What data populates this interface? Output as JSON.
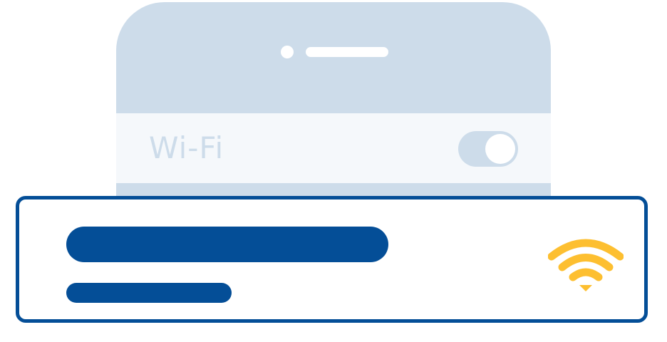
{
  "settings": {
    "wifi_label": "Wi-Fi",
    "wifi_enabled": true
  },
  "network": {
    "icon": "wifi-signal-icon"
  },
  "colors": {
    "phone_body": "#cddcea",
    "row_background": "#f5f8fb",
    "accent_blue": "#044e97",
    "signal_yellow": "#fdbf30"
  }
}
